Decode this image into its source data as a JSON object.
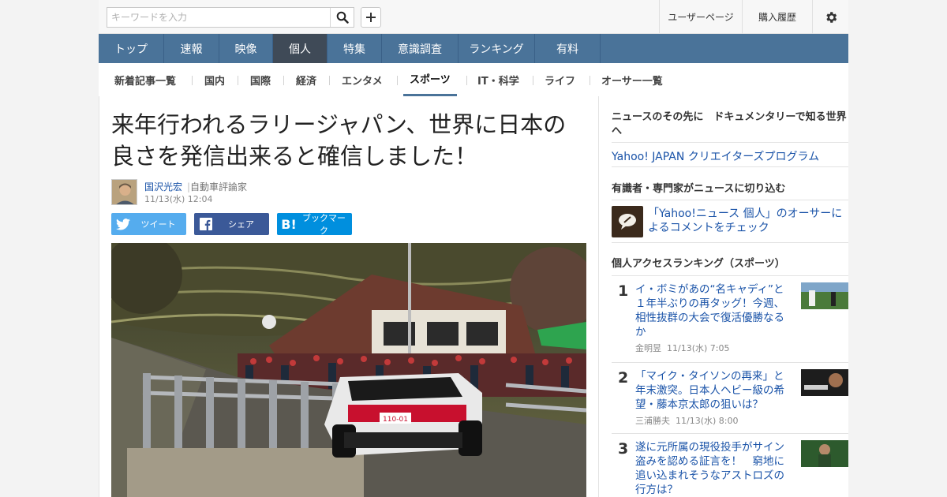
{
  "search": {
    "placeholder": "キーワードを入力"
  },
  "toplinks": {
    "user_page": "ユーザーページ",
    "purchase_history": "購入履歴"
  },
  "main_nav": [
    "トップ",
    "速報",
    "映像",
    "個人",
    "特集",
    "意識調査",
    "ランキング",
    "有料"
  ],
  "main_nav_active": "個人",
  "sub_nav": [
    "新着記事一覧",
    "国内",
    "国際",
    "経済",
    "エンタメ",
    "スポーツ",
    "IT・科学",
    "ライフ",
    "オーサー一覧"
  ],
  "sub_nav_active": "スポーツ",
  "article": {
    "title": "来年行われるラリージャパン、世界に日本の良さを発信出来ると確信しました！",
    "author": "国沢光宏",
    "author_role": "自動車評論家",
    "date": "11/13(水) 12:04",
    "share": {
      "tweet": "ツイート",
      "facebook": "シェア",
      "hatena": "ブックマーク"
    },
    "photo_plate": "110-01"
  },
  "sidebar": {
    "doc_heading": "ニュースのその先に　ドキュメンタリーで知る世界へ",
    "creators_link": "Yahoo! JAPAN クリエイターズプログラム",
    "experts_heading": "有識者・専門家がニュースに切り込む",
    "experts_link": "「Yahoo!ニュース 個人」のオーサーによるコメントをチェック",
    "ranking_heading": "個人アクセスランキング（スポーツ）",
    "ranking": [
      {
        "rank": "1",
        "title": "イ・ボミがあの“名キャディ”と１年半ぶりの再タッグ！今週、相性抜群の大会で復活優勝なるか",
        "author": "金明昱",
        "date": "11/13(水) 7:05"
      },
      {
        "rank": "2",
        "title": "「マイク・タイソンの再来」と年末激突。日本人ヘビー級の希望・藤本京太郎の狙いは？",
        "author": "三浦勝夫",
        "date": "11/13(水) 8:00"
      },
      {
        "rank": "3",
        "title": "遂に元所属の現役投手がサイン盗みを認める証言を！　窮地に追い込まれそうなアストロズの行方は？",
        "author": "",
        "date": ""
      }
    ]
  },
  "colors": {
    "nav_bg": "#4a7399",
    "nav_active": "#3f4a57",
    "link": "#1a53a8",
    "twitter": "#55acee",
    "facebook": "#3b5998",
    "hatena": "#008fde"
  },
  "icons": {
    "search": "search-icon",
    "add": "plus-icon",
    "settings": "gear-icon"
  }
}
